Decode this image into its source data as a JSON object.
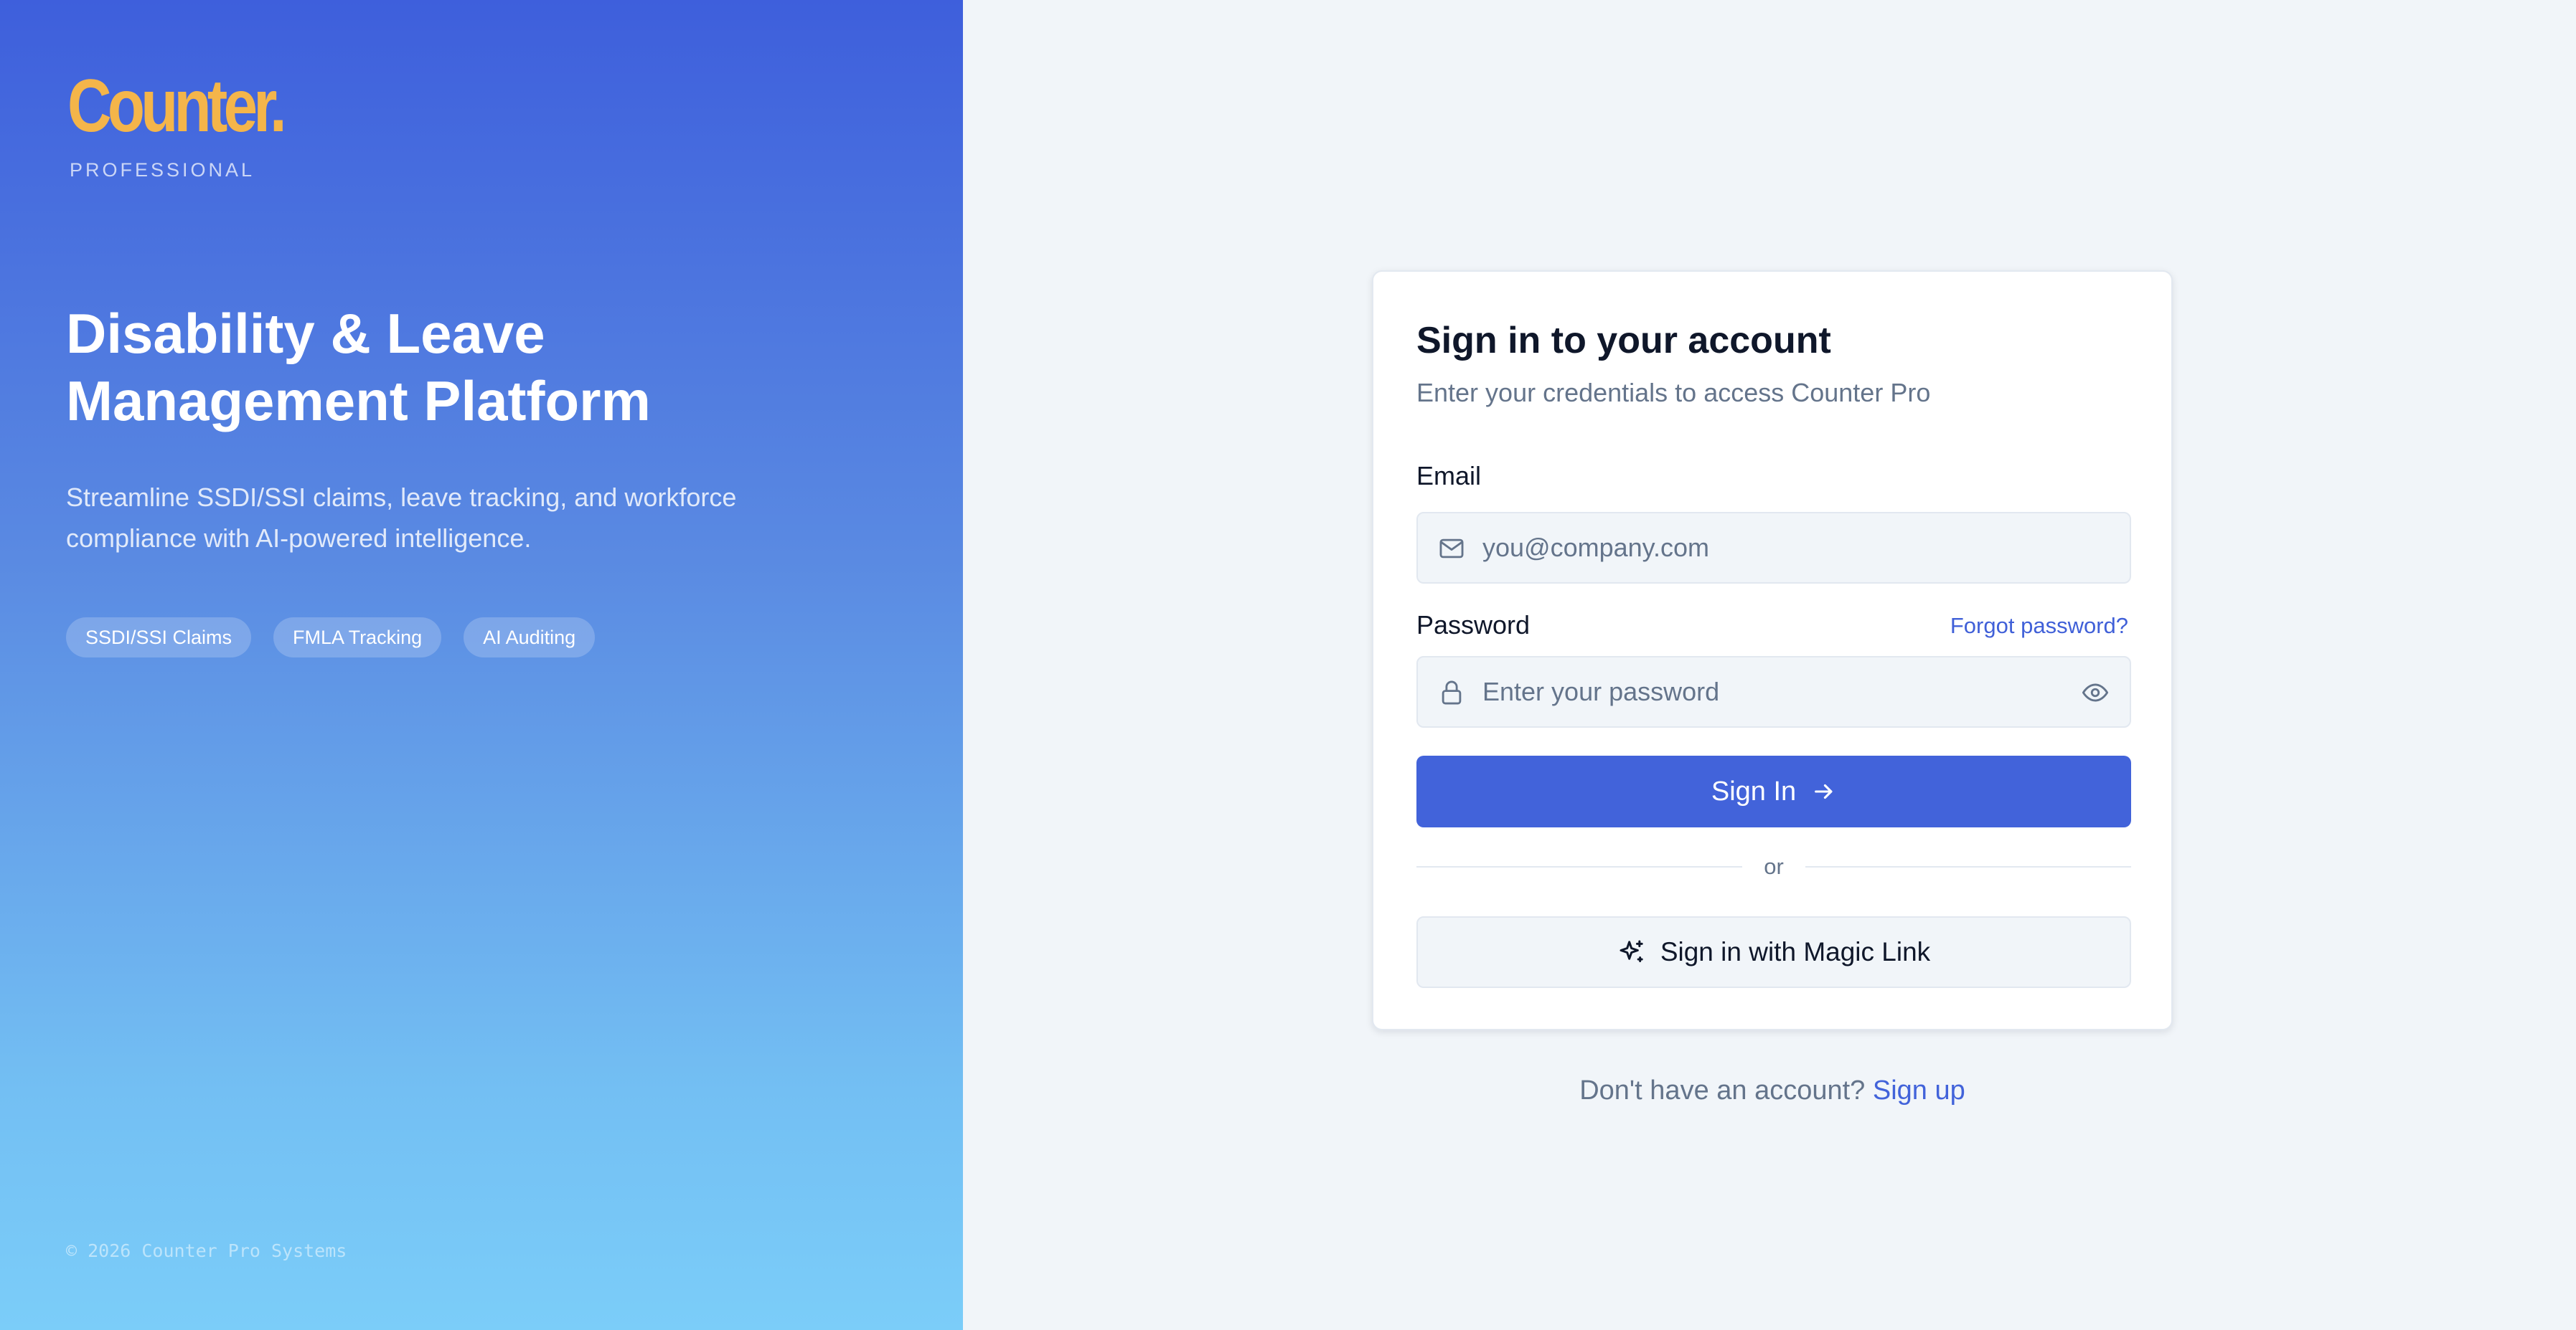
{
  "brand": {
    "logo_text": "Counter.",
    "tier": "PROFESSIONAL",
    "logo_color": "#f4b54a"
  },
  "hero": {
    "title_line1": "Disability & Leave",
    "title_line2": "Management Platform",
    "description": "Streamline SSDI/SSI claims, leave tracking, and workforce compliance with AI-powered intelligence.",
    "features": [
      "SSDI/SSI Claims",
      "FMLA Tracking",
      "AI Auditing"
    ],
    "copyright": "© 2026 Counter Pro Systems",
    "gradient_top": "#3e5fdc",
    "gradient_bottom": "#7bcdf9"
  },
  "signin": {
    "title": "Sign in to your account",
    "subtitle": "Enter your credentials to access Counter Pro",
    "email_label": "Email",
    "email_placeholder": "you@company.com",
    "email_icon": "mail-icon",
    "password_label": "Password",
    "password_placeholder": "Enter your password",
    "password_icon": "lock-icon",
    "show_password_icon": "eye-icon",
    "forgot_label": "Forgot password?",
    "submit_label": "Sign In",
    "submit_icon": "arrow-right-icon",
    "divider_label": "or",
    "magic_link_label": "Sign in with Magic Link",
    "magic_link_icon": "sparkles-icon",
    "accent_color": "#4263da"
  },
  "footer": {
    "prompt": "Don't have an account?",
    "signup_label": "Sign up"
  }
}
